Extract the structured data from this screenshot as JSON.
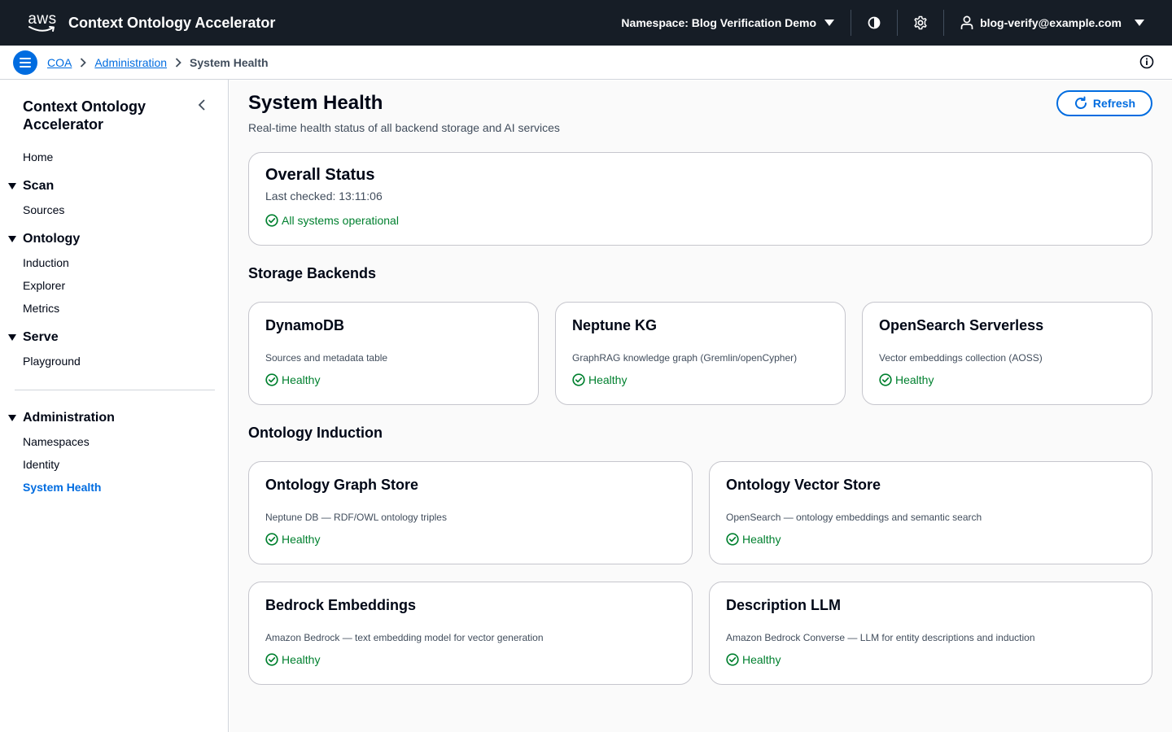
{
  "header": {
    "logo_text": "aws",
    "app_title": "Context Ontology Accelerator",
    "namespace_label": "Namespace: Blog Verification Demo",
    "user_email": "blog-verify@example.com"
  },
  "breadcrumbs": {
    "items": [
      "COA",
      "Administration"
    ],
    "current": "System Health"
  },
  "sidebar": {
    "title": "Context Ontology Accelerator",
    "home": "Home",
    "groups": {
      "scan": {
        "label": "Scan",
        "items": [
          "Sources"
        ]
      },
      "ontology": {
        "label": "Ontology",
        "items": [
          "Induction",
          "Explorer",
          "Metrics"
        ]
      },
      "serve": {
        "label": "Serve",
        "items": [
          "Playground"
        ]
      },
      "admin": {
        "label": "Administration",
        "items": [
          "Namespaces",
          "Identity",
          "System Health"
        ]
      }
    },
    "active_item": "System Health"
  },
  "page": {
    "title": "System Health",
    "description": "Real-time health status of all backend storage and AI services",
    "refresh_label": "Refresh"
  },
  "overall": {
    "title": "Overall Status",
    "last_checked": "Last checked: 13:11:06",
    "status": "All systems operational"
  },
  "storage": {
    "section_title": "Storage Backends",
    "cards": [
      {
        "title": "DynamoDB",
        "subtitle": "Sources and metadata table",
        "status": "Healthy"
      },
      {
        "title": "Neptune KG",
        "subtitle": "GraphRAG knowledge graph (Gremlin/openCypher)",
        "status": "Healthy"
      },
      {
        "title": "OpenSearch Serverless",
        "subtitle": "Vector embeddings collection (AOSS)",
        "status": "Healthy"
      }
    ]
  },
  "induction": {
    "section_title": "Ontology Induction",
    "cards": [
      {
        "title": "Ontology Graph Store",
        "subtitle": "Neptune DB — RDF/OWL ontology triples",
        "status": "Healthy"
      },
      {
        "title": "Ontology Vector Store",
        "subtitle": "OpenSearch — ontology embeddings and semantic search",
        "status": "Healthy"
      },
      {
        "title": "Bedrock Embeddings",
        "subtitle": "Amazon Bedrock — text embedding model for vector generation",
        "status": "Healthy"
      },
      {
        "title": "Description LLM",
        "subtitle": "Amazon Bedrock Converse — LLM for entity descriptions and induction",
        "status": "Healthy"
      }
    ]
  },
  "icons": {
    "status_ok": "check-circle-icon",
    "refresh": "refresh-icon",
    "theme": "contrast-icon",
    "settings": "gear-icon",
    "user": "user-icon",
    "info": "info-icon",
    "menu": "menu-icon"
  },
  "colors": {
    "top_nav_bg": "#161d26",
    "accent": "#006ce0",
    "success": "#00802f",
    "main_bg": "#fafafa",
    "border": "#c6c6cd"
  }
}
